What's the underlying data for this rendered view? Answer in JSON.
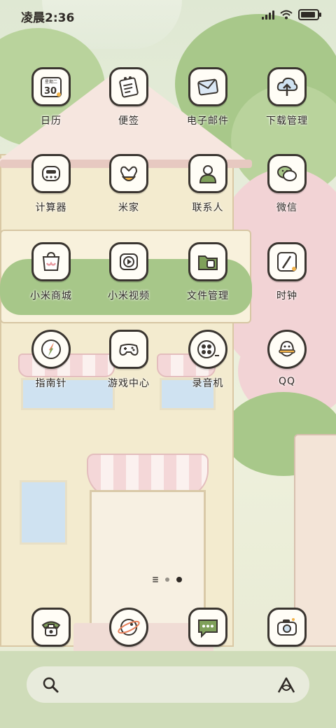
{
  "status_bar": {
    "time": "凌晨2:36"
  },
  "apps": [
    {
      "id": "calendar",
      "label": "日历",
      "icon": "calendar-icon",
      "calendar_weekday": "星期二",
      "calendar_day": "30"
    },
    {
      "id": "notes",
      "label": "便签",
      "icon": "notes-icon"
    },
    {
      "id": "email",
      "label": "电子邮件",
      "icon": "email-icon"
    },
    {
      "id": "downloads",
      "label": "下载管理",
      "icon": "download-icon"
    },
    {
      "id": "calculator",
      "label": "计算器",
      "icon": "calculator-icon"
    },
    {
      "id": "mihome",
      "label": "米家",
      "icon": "mihome-icon"
    },
    {
      "id": "contacts",
      "label": "联系人",
      "icon": "contacts-icon"
    },
    {
      "id": "wechat",
      "label": "微信",
      "icon": "wechat-icon"
    },
    {
      "id": "mistore",
      "label": "小米商城",
      "icon": "shopping-bag-icon"
    },
    {
      "id": "mivideo",
      "label": "小米视频",
      "icon": "video-play-icon"
    },
    {
      "id": "files",
      "label": "文件管理",
      "icon": "folder-icon"
    },
    {
      "id": "clock",
      "label": "时钟",
      "icon": "clock-icon"
    },
    {
      "id": "compass",
      "label": "指南针",
      "icon": "compass-icon"
    },
    {
      "id": "games",
      "label": "游戏中心",
      "icon": "gamepad-icon"
    },
    {
      "id": "recorder",
      "label": "录音机",
      "icon": "recorder-icon"
    },
    {
      "id": "qq",
      "label": "QQ",
      "icon": "qq-icon"
    }
  ],
  "dock": [
    {
      "id": "phone",
      "icon": "phone-icon"
    },
    {
      "id": "browser",
      "icon": "browser-icon"
    },
    {
      "id": "messages",
      "icon": "message-icon"
    },
    {
      "id": "camera",
      "icon": "camera-icon"
    }
  ],
  "page_indicator": {
    "pages": 3,
    "active": 3
  },
  "search": {
    "icons": [
      "search-icon",
      "assistant-icon"
    ]
  },
  "colors": {
    "icon_outline": "#3a3530",
    "icon_fill": "#fffdf6",
    "accent_green": "#7fa05a",
    "accent_orange": "#f2b34a"
  }
}
